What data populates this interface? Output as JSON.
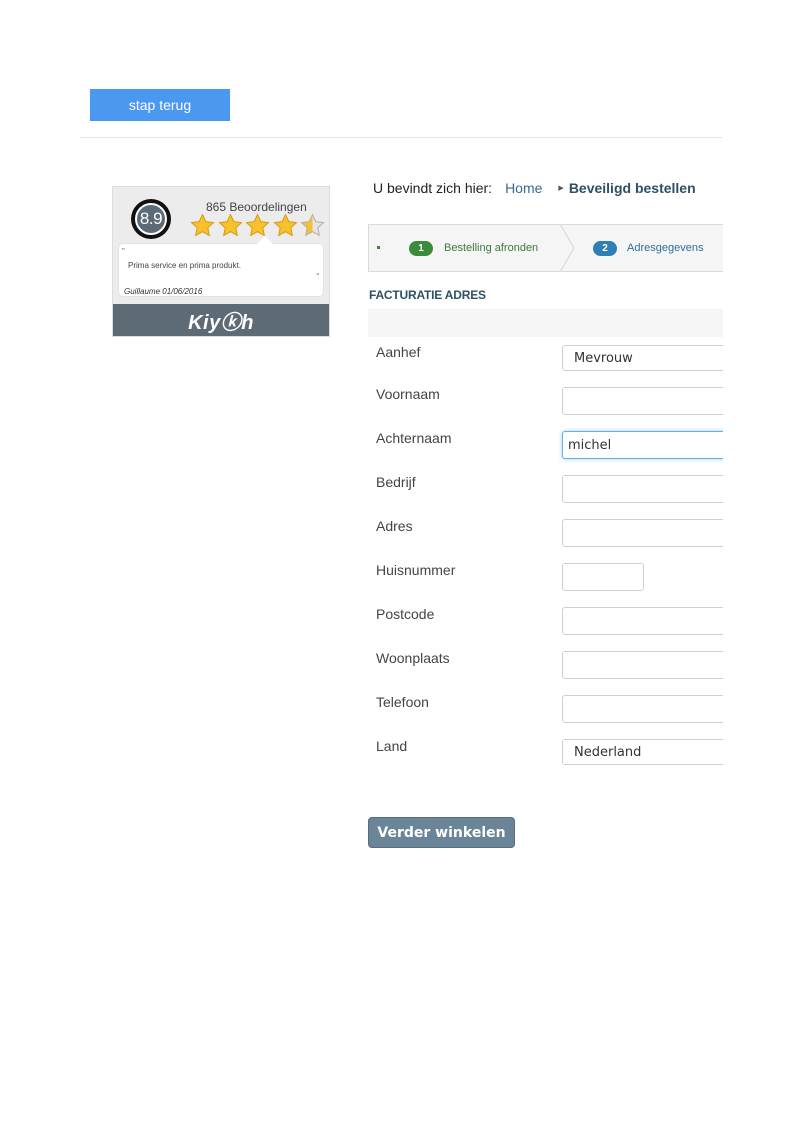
{
  "navigation": {
    "back_label": "stap terug"
  },
  "kiyoh": {
    "score": "8.9",
    "review_count": "865 Beoordelingen",
    "rating_stars": 4.5,
    "review_text": "Prima service en prima produkt.",
    "review_author": "Guillaume 01/06/2016",
    "brand": "Kiyⓚh",
    "quote_open": "„",
    "quote_close": "“"
  },
  "breadcrumb": {
    "prefix": "U bevindt zich hier:",
    "home": "Home",
    "current": "Beveiligd bestellen"
  },
  "steps": [
    {
      "number": "1",
      "label": "Bestelling afronden"
    },
    {
      "number": "2",
      "label": "Adresgegevens"
    }
  ],
  "section": {
    "title": "FACTURATIE ADRES"
  },
  "form": {
    "aanhef": {
      "label": "Aanhef",
      "value": "Mevrouw"
    },
    "voornaam": {
      "label": "Voornaam",
      "value": ""
    },
    "achternaam": {
      "label": "Achternaam",
      "value": "michel"
    },
    "bedrijf": {
      "label": "Bedrijf",
      "value": ""
    },
    "adres": {
      "label": "Adres",
      "value": ""
    },
    "huisnummer": {
      "label": "Huisnummer",
      "value": ""
    },
    "postcode": {
      "label": "Postcode",
      "value": ""
    },
    "woonplaats": {
      "label": "Woonplaats",
      "value": ""
    },
    "telefoon": {
      "label": "Telefoon",
      "value": ""
    },
    "land": {
      "label": "Land",
      "value": "Nederland"
    }
  },
  "actions": {
    "continue_label": "Verder winkelen"
  },
  "colors": {
    "primary_button": "#4a98f0",
    "widget_bar": "#5d6b77",
    "step_done": "#3b8b3b",
    "step_active": "#2f7fb5",
    "continue_button": "#6a8597",
    "star": "#f7c12d"
  }
}
